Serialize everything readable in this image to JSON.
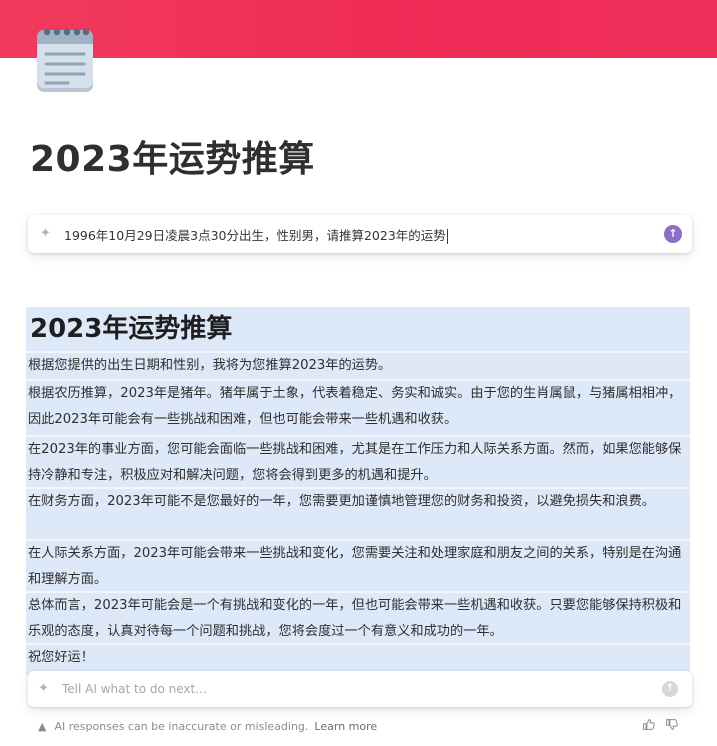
{
  "page": {
    "title": "2023年运势推算",
    "cover_color": "#f0305b",
    "icon": "notepad-icon"
  },
  "prompt": {
    "text": "1996年10月29日凌晨3点30分出生，性别男，请推算2023年的运势"
  },
  "result": {
    "heading": "2023年运势推算",
    "paragraphs": [
      "根据您提供的出生日期和性别，我将为您推算2023年的运势。",
      "根据农历推算，2023年是猪年。猪年属于土象，代表着稳定、务实和诚实。由于您的生肖属鼠，与猪属相相冲，因此2023年可能会有一些挑战和困难，但也可能会带来一些机遇和收获。",
      "在2023年的事业方面，您可能会面临一些挑战和困难，尤其是在工作压力和人际关系方面。然而，如果您能够保持冷静和专注，积极应对和解决问题，您将会得到更多的机遇和提升。",
      "在财务方面，2023年可能不是您最好的一年，您需要更加谨慎地管理您的财务和投资，以避免损失和浪费。",
      "在人际关系方面，2023年可能会带来一些挑战和变化，您需要关注和处理家庭和朋友之间的关系，特别是在沟通和理解方面。",
      "总体而言，2023年可能会是一个有挑战和变化的一年，但也可能会带来一些机遇和收获。只要您能够保持积极和乐观的态度，认真对待每一个问题和挑战，您将会度过一个有意义和成功的一年。",
      "祝您好运！"
    ],
    "highlight_color": "#dde8f8"
  },
  "ask": {
    "placeholder": "Tell AI what to do next..."
  },
  "footer": {
    "disclaimer": "AI responses can be inaccurate or misleading.",
    "learn_more": "Learn more"
  }
}
